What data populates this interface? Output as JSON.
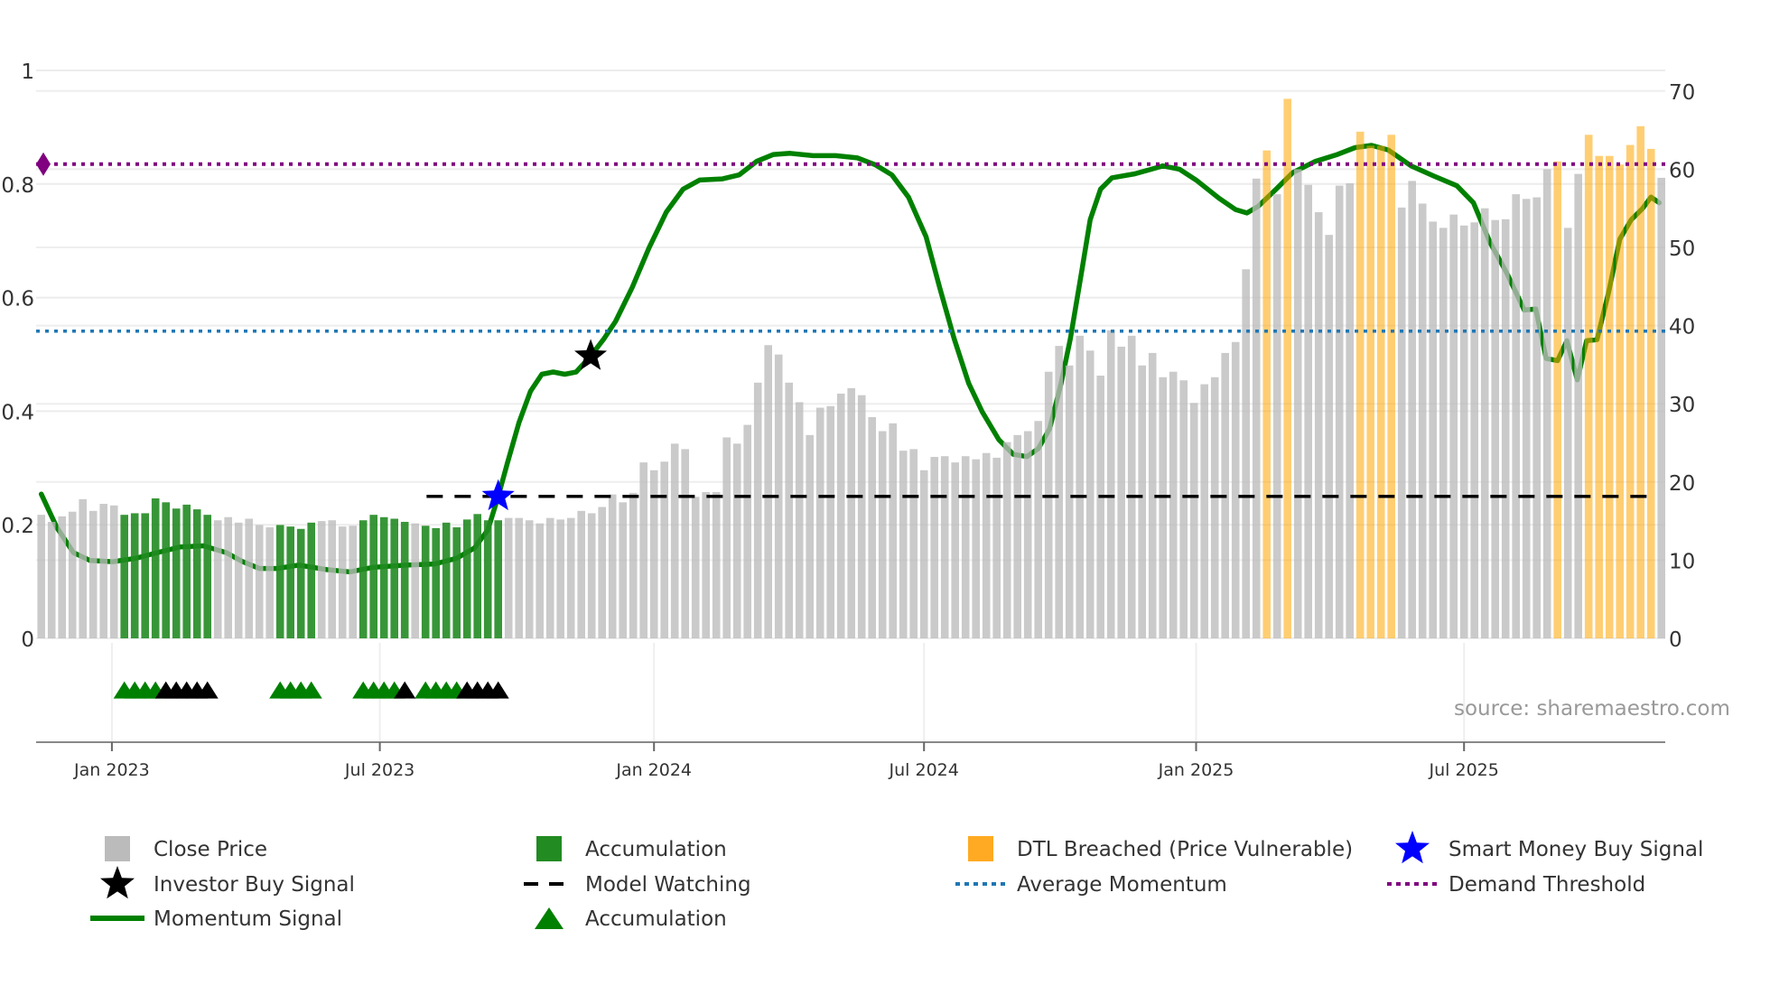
{
  "chart_data": {
    "type": "bar",
    "title": "",
    "xlabel": "",
    "ylabel_left": "",
    "ylabel_right": "",
    "left_axis": {
      "range": [
        0,
        1
      ],
      "ticks": [
        "0",
        "0.2",
        "0.4",
        "0.6",
        "0.8",
        "1"
      ]
    },
    "right_axis": {
      "range": [
        0,
        70
      ],
      "ticks": [
        "0",
        "10",
        "20",
        "30",
        "40",
        "50",
        "60",
        "70"
      ]
    },
    "x_axis": {
      "unit": "week index",
      "ticks": [
        {
          "label": "Jan 2023",
          "x": 6.8
        },
        {
          "label": "Jul 2023",
          "x": 32.6
        },
        {
          "label": "Jan 2024",
          "x": 59.0
        },
        {
          "label": "Jul 2024",
          "x": 85.0
        },
        {
          "label": "Jan 2025",
          "x": 111.2
        },
        {
          "label": "Jul 2025",
          "x": 137.0
        }
      ]
    },
    "grid": true,
    "colors": {
      "close": "#bbbbbb",
      "accum": "#228b22",
      "dtl": "#ffa500",
      "momentum": "#008000",
      "average": "#1f77b4",
      "demand": "#800080",
      "watching": "#000000",
      "smart_star": "#0000ff",
      "investor_star": "#000000",
      "tri_green": "#008000",
      "tri_black": "#000000"
    },
    "close_price": [
      15.8,
      14.9,
      15.6,
      16.2,
      17.8,
      16.3,
      17.2,
      17.0,
      15.8,
      16.0,
      16.0,
      17.9,
      17.4,
      16.6,
      17.1,
      16.5,
      15.8,
      15.1,
      15.5,
      14.8,
      15.3,
      14.5,
      14.2,
      14.5,
      14.3,
      14.0,
      14.8,
      15.0,
      15.1,
      14.3,
      14.4,
      15.1,
      15.8,
      15.5,
      15.3,
      14.9,
      14.7,
      14.4,
      14.1,
      14.8,
      14.2,
      15.2,
      15.9,
      15.1,
      15.1,
      15.4,
      15.4,
      15.1,
      14.7,
      15.4,
      15.2,
      15.4,
      16.3,
      16.0,
      16.8,
      18.4,
      17.4,
      18.6,
      22.5,
      21.5,
      22.6,
      24.9,
      24.2,
      18.1,
      18.7,
      18.7,
      25.7,
      24.9,
      27.3,
      32.7,
      37.5,
      36.3,
      32.7,
      30.2,
      26.0,
      29.5,
      29.7,
      31.3,
      32.0,
      31.1,
      28.3,
      26.5,
      27.5,
      24.0,
      24.2,
      21.5,
      23.2,
      23.3,
      22.5,
      23.3,
      22.9,
      23.7,
      23.1,
      25.1,
      26.0,
      26.5,
      27.8,
      34.1,
      37.4,
      34.9,
      38.7,
      36.8,
      33.6,
      39.4,
      37.3,
      38.7,
      34.9,
      36.5,
      33.4,
      34.1,
      33.0,
      30.1,
      32.5,
      33.4,
      36.5,
      37.9,
      47.2,
      58.8,
      62.4,
      56.8,
      69.0,
      60.0,
      58.0,
      54.5,
      51.6,
      57.9,
      58.2,
      64.8,
      63.0,
      63.0,
      64.4,
      55.1,
      58.5,
      55.6,
      53.3,
      52.5,
      54.2,
      52.8,
      53.2,
      55.0,
      53.5,
      53.6,
      56.8,
      56.2,
      56.4,
      60.0,
      61.0,
      52.5,
      59.4,
      64.4,
      61.7,
      61.7,
      60.6,
      63.1,
      65.5,
      62.6,
      58.9
    ],
    "accumulation_ranges": [
      [
        8,
        16
      ],
      [
        23,
        26
      ],
      [
        31,
        35
      ],
      [
        37,
        44
      ]
    ],
    "dtl_breached_indices": [
      118,
      120,
      127,
      128,
      129,
      130,
      146,
      149,
      150,
      151,
      152,
      153,
      154,
      155
    ],
    "momentum_signal": [
      [
        0,
        0.254
      ],
      [
        1.5,
        0.195
      ],
      [
        3.1,
        0.151
      ],
      [
        4.7,
        0.137
      ],
      [
        6.9,
        0.135
      ],
      [
        9.1,
        0.141
      ],
      [
        11.2,
        0.151
      ],
      [
        13.4,
        0.161
      ],
      [
        15.6,
        0.163
      ],
      [
        17.8,
        0.151
      ],
      [
        19.4,
        0.135
      ],
      [
        21.0,
        0.123
      ],
      [
        22.7,
        0.123
      ],
      [
        24.8,
        0.129
      ],
      [
        27.5,
        0.121
      ],
      [
        29.7,
        0.117
      ],
      [
        31.9,
        0.125
      ],
      [
        35.1,
        0.129
      ],
      [
        37.9,
        0.131
      ],
      [
        40.0,
        0.141
      ],
      [
        41.7,
        0.159
      ],
      [
        43.0,
        0.191
      ],
      [
        44.0,
        0.25
      ],
      [
        44.9,
        0.31
      ],
      [
        46.0,
        0.38
      ],
      [
        47.1,
        0.435
      ],
      [
        48.2,
        0.465
      ],
      [
        49.3,
        0.469
      ],
      [
        50.4,
        0.465
      ],
      [
        51.5,
        0.469
      ],
      [
        52.9,
        0.497
      ],
      [
        54.2,
        0.528
      ],
      [
        55.3,
        0.558
      ],
      [
        56.9,
        0.618
      ],
      [
        58.5,
        0.687
      ],
      [
        60.2,
        0.751
      ],
      [
        61.8,
        0.791
      ],
      [
        63.4,
        0.807
      ],
      [
        65.6,
        0.809
      ],
      [
        67.2,
        0.816
      ],
      [
        68.9,
        0.84
      ],
      [
        70.5,
        0.852
      ],
      [
        72.1,
        0.854
      ],
      [
        74.3,
        0.85
      ],
      [
        76.5,
        0.85
      ],
      [
        78.6,
        0.846
      ],
      [
        80.3,
        0.834
      ],
      [
        81.9,
        0.816
      ],
      [
        83.5,
        0.777
      ],
      [
        85.2,
        0.707
      ],
      [
        86.5,
        0.618
      ],
      [
        87.9,
        0.528
      ],
      [
        89.3,
        0.449
      ],
      [
        90.6,
        0.399
      ],
      [
        92.2,
        0.35
      ],
      [
        93.6,
        0.324
      ],
      [
        94.9,
        0.32
      ],
      [
        96.0,
        0.334
      ],
      [
        97.1,
        0.369
      ],
      [
        98.2,
        0.449
      ],
      [
        99.1,
        0.528
      ],
      [
        100.2,
        0.648
      ],
      [
        101.0,
        0.737
      ],
      [
        102.0,
        0.791
      ],
      [
        103.1,
        0.811
      ],
      [
        105.3,
        0.818
      ],
      [
        106.9,
        0.826
      ],
      [
        108.0,
        0.832
      ],
      [
        109.6,
        0.826
      ],
      [
        111.2,
        0.807
      ],
      [
        113.4,
        0.775
      ],
      [
        115.0,
        0.755
      ],
      [
        116.1,
        0.749
      ],
      [
        117.2,
        0.761
      ],
      [
        118.9,
        0.791
      ],
      [
        120.5,
        0.82
      ],
      [
        122.7,
        0.84
      ],
      [
        124.8,
        0.852
      ],
      [
        126.5,
        0.864
      ],
      [
        128.1,
        0.868
      ],
      [
        129.7,
        0.86
      ],
      [
        131.9,
        0.832
      ],
      [
        134.1,
        0.814
      ],
      [
        136.3,
        0.797
      ],
      [
        137.9,
        0.767
      ],
      [
        139.5,
        0.697
      ],
      [
        141.1,
        0.644
      ],
      [
        142.8,
        0.578
      ],
      [
        143.9,
        0.58
      ],
      [
        144.9,
        0.493
      ],
      [
        146.0,
        0.489
      ],
      [
        146.9,
        0.524
      ],
      [
        147.9,
        0.455
      ],
      [
        148.8,
        0.524
      ],
      [
        149.8,
        0.526
      ],
      [
        150.9,
        0.608
      ],
      [
        152.0,
        0.703
      ],
      [
        153.1,
        0.737
      ],
      [
        154.2,
        0.757
      ],
      [
        155.0,
        0.777
      ],
      [
        155.8,
        0.767
      ]
    ],
    "average_momentum": 0.541,
    "demand_threshold": 0.835,
    "model_watching": {
      "level": 0.25,
      "from": 37.1,
      "to": 155
    },
    "smart_money_buy_signal": {
      "x": 44,
      "y": 0.25
    },
    "investor_buy_signal": {
      "x": 52.9,
      "y": 0.497
    },
    "accumulation_markers": {
      "y": -0.09,
      "green": [
        8,
        9,
        10,
        11,
        23,
        24,
        25,
        26,
        31,
        32,
        33,
        34,
        37,
        38,
        39,
        40
      ],
      "black": [
        12,
        13,
        14,
        15,
        16,
        35,
        41,
        42,
        43,
        44
      ]
    }
  },
  "legend": {
    "placement": "bottom",
    "items": [
      {
        "label": "Close Price",
        "symbol": "square",
        "color": "#bbbbbb"
      },
      {
        "label": "Accumulation",
        "symbol": "square",
        "color": "#228b22"
      },
      {
        "label": "DTL Breached (Price Vulnerable)",
        "symbol": "square",
        "color": "#ffaa22"
      },
      {
        "label": "Smart Money Buy Signal",
        "symbol": "star",
        "color": "#0000ff"
      },
      {
        "label": "Investor Buy Signal",
        "symbol": "star",
        "color": "#000000"
      },
      {
        "label": "Model Watching",
        "symbol": "dash",
        "color": "#000000"
      },
      {
        "label": "Average Momentum",
        "symbol": "dot",
        "color": "#1f77b4"
      },
      {
        "label": "Demand Threshold",
        "symbol": "dot",
        "color": "#800080"
      },
      {
        "label": "Momentum Signal",
        "symbol": "line",
        "color": "#008000"
      },
      {
        "label": "Accumulation",
        "symbol": "triangle",
        "color": "#008000"
      }
    ]
  },
  "source": "source: sharemaestro.com"
}
